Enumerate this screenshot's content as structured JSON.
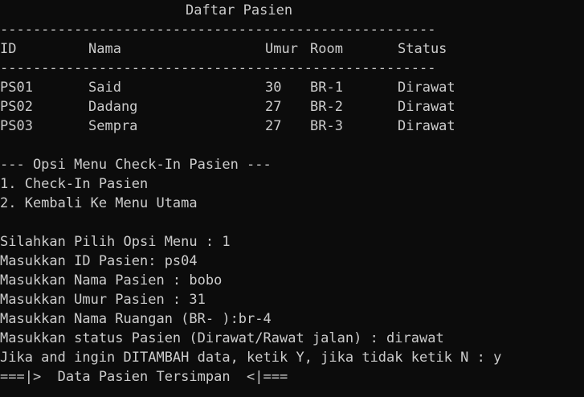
{
  "table": {
    "title": "Daftar Pasien",
    "separator": "-----------------------------------------------------",
    "headers": {
      "id": "ID",
      "nama": "Nama",
      "umur": "Umur",
      "room": "Room",
      "status": "Status"
    },
    "rows": [
      {
        "id": "PS01",
        "nama": "Said",
        "umur": "30",
        "room": "BR-1",
        "status": "Dirawat"
      },
      {
        "id": "PS02",
        "nama": "Dadang",
        "umur": "27",
        "room": "BR-2",
        "status": "Dirawat"
      },
      {
        "id": "PS03",
        "nama": "Sempra",
        "umur": "27",
        "room": "BR-3",
        "status": "Dirawat"
      }
    ]
  },
  "menu": {
    "heading": "--- Opsi Menu Check-In Pasien ---",
    "option_1": "1. Check-In Pasien",
    "option_2": "2. Kembali Ke Menu Utama"
  },
  "session": {
    "pilih_opsi": "Silahkan Pilih Opsi Menu : 1",
    "input_id": "Masukkan ID Pasien: ps04",
    "input_nama": "Masukkan Nama Pasien : bobo",
    "input_umur": "Masukkan Umur Pasien : 31",
    "input_ruangan": "Masukkan Nama Ruangan (BR- ):br-4",
    "input_status": "Masukkan status Pasien (Dirawat/Rawat jalan) : dirawat",
    "prompt_tambah": "Jika and ingin DITAMBAH data, ketik Y, jika tidak ketik N : y",
    "saved_message": "===|>  Data Pasien Tersimpan  <|==="
  }
}
